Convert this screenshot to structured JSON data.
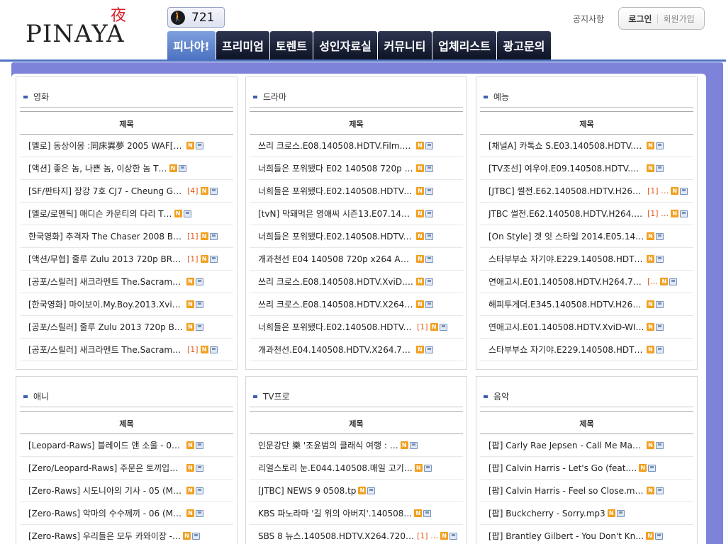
{
  "header": {
    "logo_text": "PINAYA",
    "logo_mark": "夜",
    "counter_icon": "walker-icon",
    "counter_value": "721",
    "notice_label": "공지사항",
    "login_label": "로그인",
    "separator": "|",
    "join_label": "회원가입"
  },
  "nav": {
    "tabs": [
      {
        "label": "피나야!"
      },
      {
        "label": "프리미엄"
      },
      {
        "label": "토렌트"
      },
      {
        "label": "성인자료실"
      },
      {
        "label": "커뮤니티"
      },
      {
        "label": "업체리스트"
      },
      {
        "label": "광고문의"
      }
    ]
  },
  "colors": {
    "accent": "#4d73c2",
    "main_bg": "#7c83d9",
    "count": "#e05a1e",
    "new_badge": "#f0a020"
  },
  "badges": {
    "new": "N"
  },
  "column_header": "제목",
  "panels": [
    {
      "title": "영화",
      "rows": [
        {
          "title": "[멜로] 동상이몽 :同床異夢 2005 WAF[U…",
          "count": ""
        },
        {
          "title": "[액션] 좋은 놈, 나쁜 놈, 이상한 놈 T…",
          "count": ""
        },
        {
          "title": "[SF/판타지] 장강 7호 CJ7 - Cheung Go…",
          "count": "[4]"
        },
        {
          "title": "[멜로/로멘틱] 매디슨 카운티의 다리 T…",
          "count": ""
        },
        {
          "title": "한국영화] 추격자 The Chaser 2008 BRR…",
          "count": "[1]"
        },
        {
          "title": "[액션/무협] 줄루 Zulu 2013 720p BRRi…",
          "count": "[1]"
        },
        {
          "title": "[공포/스릴러] 새크라멘트 The.Sacrame…",
          "count": ""
        },
        {
          "title": "[한국영화] 마이보이.My.Boy.2013.XviD…",
          "count": ""
        },
        {
          "title": "[공포/스릴러] 줄루 Zulu 2013 720p BR…",
          "count": ""
        },
        {
          "title": "[공포/스릴러] 새크라멘트 The.Sacrame…",
          "count": "[1]"
        }
      ]
    },
    {
      "title": "드라마",
      "rows": [
        {
          "title": "쓰리 크로스.E08.140508.HDTV.Film.x26…",
          "count": ""
        },
        {
          "title": "너희들은 포위됐다 E02 140508 720p HD…",
          "count": ""
        },
        {
          "title": "너희들은 포위됐다.E02.140508.HDTV-Fi…",
          "count": ""
        },
        {
          "title": "[tvN] 막돼먹은 영애씨 시즌13.E07.140…",
          "count": ""
        },
        {
          "title": "너희들은 포위됐다.E02.140508.HDTV.fi…",
          "count": ""
        },
        {
          "title": "개과천선 E04 140508 720p x264 AAC-Cr…",
          "count": ""
        },
        {
          "title": "쓰리 크로스.E08.140508.HDTV.XviD.450…",
          "count": ""
        },
        {
          "title": "쓰리 크로스.E08.140508.HDTV.X264.720…",
          "count": ""
        },
        {
          "title": "너희들은 포위됐다.E02.140508.HDTV.Xv…",
          "count": "[1]"
        },
        {
          "title": "개과천선.E04.140508.HDTV.X264.720p-B…",
          "count": ""
        }
      ]
    },
    {
      "title": "예능",
      "rows": [
        {
          "title": "[채널A] 카톡쇼 S.E03.140508.HDTV.H26…",
          "count": ""
        },
        {
          "title": "[TV조선] 여우야.E09.140508.HDTV.H264…",
          "count": ""
        },
        {
          "title": "[JTBC] 썰전.E62.140508.HDTV.H264.720…",
          "count": "[1] …"
        },
        {
          "title": "JTBC 썰전.E62.140508.HDTV.H264.720p-…",
          "count": "[1] …"
        },
        {
          "title": "[On Style] 겟 잇 스타일 2014.E05.140…",
          "count": ""
        },
        {
          "title": "스타부부쇼 자기야.E229.140508.HDTV.H…",
          "count": ""
        },
        {
          "title": "연애고시.E01.140508.HDTV.H264.720p-WITH",
          "count": "[…"
        },
        {
          "title": "해피투게더.E345.140508.HDTV.H264.720…",
          "count": ""
        },
        {
          "title": "연애고시.E01.140508.HDTV.XviD-WITH",
          "count": ""
        },
        {
          "title": "스타부부쇼 자기야.E229.140508.HDTV.X…",
          "count": ""
        }
      ]
    },
    {
      "title": "애니",
      "rows": [
        {
          "title": "[Leopard-Raws] 블레이드 앤 소울 - 06…",
          "count": ""
        },
        {
          "title": "[Zero/Leopard-Raws] 주문은 토끼입니…",
          "count": ""
        },
        {
          "title": "[Zero-Raws] 시도니아의 기사 - 05 (MB…",
          "count": ""
        },
        {
          "title": "[Zero-Raws] 악마의 수수께끼 - 06 (MB…",
          "count": ""
        },
        {
          "title": "[Zero-Raws] 우리들은 모두 카와이장 -…",
          "count": ""
        }
      ]
    },
    {
      "title": "TV프로",
      "rows": [
        {
          "title": "인문강단 樂 '조윤범의 클래식 여행 : …",
          "count": ""
        },
        {
          "title": "리얼스토리 눈.E044.140508.매일 고기…",
          "count": ""
        },
        {
          "title": "[JTBC] NEWS 9 0508.tp",
          "count": ""
        },
        {
          "title": "KBS 파노라마 '길 위의 아버지'.140508…",
          "count": ""
        },
        {
          "title": "SBS 8 뉴스.140508.HDTV.X264.720p-BarosG",
          "count": "[1] …"
        }
      ]
    },
    {
      "title": "음악",
      "rows": [
        {
          "title": "[팝] Carly Rae Jepsen - Call Me Mayb…",
          "count": ""
        },
        {
          "title": "[팝] Calvin Harris - Let's Go (feat.…",
          "count": ""
        },
        {
          "title": "[팝] Calvin Harris - Feel so Close.mp3",
          "count": ""
        },
        {
          "title": "[팝] Buckcherry - Sorry.mp3",
          "count": ""
        },
        {
          "title": "[팝] Brantley Gilbert - You Don't Kn…",
          "count": ""
        }
      ]
    }
  ]
}
